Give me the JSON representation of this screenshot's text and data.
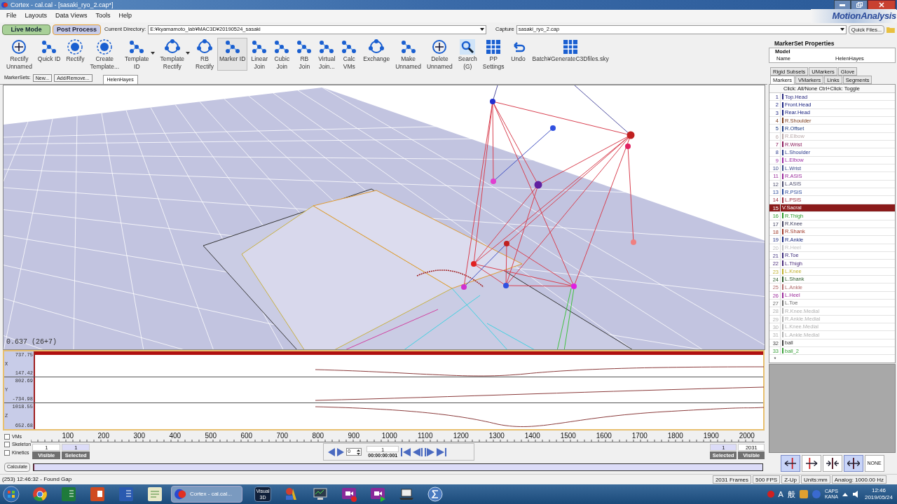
{
  "window": {
    "title": "Cortex  - cal.cal - [sasaki_ryo_2.cap*]"
  },
  "menu": [
    "File",
    "Layouts",
    "Data Views",
    "Tools",
    "Help"
  ],
  "modes": [
    {
      "label": "Live Mode",
      "selected": false
    },
    {
      "label": "Post Process",
      "selected": true
    }
  ],
  "directory": {
    "label": "Current Directory:",
    "value": "E:¥kyamamoto_lab¥MAC3D¥20190524_sasaki"
  },
  "capture": {
    "label": "Capture",
    "value": "sasaki_ryo_2.cap"
  },
  "quick_files": "Quick Files...",
  "logo": "MotionAnalysis",
  "toolbar": [
    {
      "lines": [
        "Rectify",
        "Unnamed"
      ],
      "kind": "cross",
      "dropdown": false,
      "selected": false
    },
    {
      "lines": [
        "Quick ID"
      ],
      "kind": "dots",
      "dropdown": false,
      "selected": false
    },
    {
      "lines": [
        "Rectify"
      ],
      "kind": "target",
      "dropdown": false,
      "selected": false
    },
    {
      "lines": [
        "Create",
        "Template..."
      ],
      "kind": "target",
      "dropdown": false,
      "selected": false
    },
    {
      "lines": [
        "Template",
        "ID"
      ],
      "kind": "dots",
      "dropdown": true,
      "selected": false
    },
    {
      "lines": [
        "Template",
        "Rectify"
      ],
      "kind": "ring",
      "dropdown": true,
      "selected": false
    },
    {
      "lines": [
        "RB",
        "Rectify"
      ],
      "kind": "ring",
      "dropdown": false,
      "selected": false
    },
    {
      "lines": [
        "Marker ID"
      ],
      "kind": "dots",
      "dropdown": false,
      "selected": true
    },
    {
      "lines": [
        "Linear",
        "Join"
      ],
      "kind": "dots",
      "dropdown": false,
      "selected": false
    },
    {
      "lines": [
        "Cubic",
        "Join"
      ],
      "kind": "dots",
      "dropdown": false,
      "selected": false
    },
    {
      "lines": [
        "RB",
        "Join"
      ],
      "kind": "dots",
      "dropdown": false,
      "selected": false
    },
    {
      "lines": [
        "Virtual",
        "Join..."
      ],
      "kind": "dots",
      "dropdown": false,
      "selected": false
    },
    {
      "lines": [
        "Calc",
        "VMs"
      ],
      "kind": "dots",
      "dropdown": false,
      "selected": false
    },
    {
      "lines": [
        "Exchange"
      ],
      "kind": "ring",
      "dropdown": false,
      "selected": false
    },
    {
      "lines": [
        "Make",
        "Unnamed"
      ],
      "kind": "dots",
      "dropdown": false,
      "selected": false
    },
    {
      "lines": [
        "Delete",
        "Unnamed"
      ],
      "kind": "cross",
      "dropdown": false,
      "selected": false
    },
    {
      "lines": [
        "Search",
        "(G)"
      ],
      "kind": "search",
      "dropdown": false,
      "selected": false
    },
    {
      "lines": [
        "PP",
        "Settings"
      ],
      "kind": "grid",
      "dropdown": false,
      "selected": false
    },
    {
      "lines": [
        "Undo"
      ],
      "kind": "undo",
      "dropdown": false,
      "selected": false
    },
    {
      "lines": [
        "Batch¥GenerateC3Dfiles.sky"
      ],
      "kind": "grid",
      "dropdown": false,
      "selected": false
    }
  ],
  "marker_sets": {
    "label": "MarkerSets:",
    "buttons": [
      "New...",
      "Add/Remove..."
    ],
    "tabs": [
      {
        "label": "HelenHayes",
        "selected": true
      }
    ]
  },
  "viewport": {
    "readout": "0.637 (26+7)"
  },
  "graphs": [
    {
      "axis": "X",
      "max": "737.75",
      "min": "147.42"
    },
    {
      "axis": "Y",
      "max": "802.69",
      "min": "-734.98"
    },
    {
      "axis": "Z",
      "max": "1018.55",
      "min": "652.68"
    }
  ],
  "ruler": [
    "100",
    "200",
    "300",
    "400",
    "500",
    "600",
    "700",
    "800",
    "900",
    "1000",
    "1100",
    "1200",
    "1300",
    "1400",
    "1500",
    "1600",
    "1700",
    "1800",
    "1900",
    "2000"
  ],
  "options": [
    {
      "label": "VMs",
      "checked": false
    },
    {
      "label": "Skeleton",
      "checked": false
    },
    {
      "label": "Kinetics",
      "checked": false
    }
  ],
  "range_left": {
    "first": "1",
    "second": "1",
    "first_label": "Visible",
    "second_label": "Selected"
  },
  "playback": {
    "step": "0",
    "frame": "1",
    "timecode": "00:00:00:001"
  },
  "range_right": {
    "first": "1",
    "second": "2031",
    "first_label": "Selected",
    "second_label": "Visible"
  },
  "calculate": {
    "label": "Calculate",
    "level": 0
  },
  "status": {
    "message": "(253) 12:46:32 - Found Gap",
    "fields": [
      "2031 Frames",
      "500 FPS",
      "Z-Up",
      "Units:mm",
      "Analog: 1000.00 Hz"
    ]
  },
  "properties": {
    "title": "MarkerSet Properties",
    "group": "Model",
    "rows": [
      {
        "name": "Name",
        "value": "HelenHayes"
      }
    ]
  },
  "tab_rows": [
    [
      {
        "label": "Rigid Subsets",
        "selected": false
      },
      {
        "label": "UMarkers",
        "selected": false
      },
      {
        "label": "Glove",
        "selected": false
      }
    ],
    [
      {
        "label": "Markers",
        "selected": true
      },
      {
        "label": "VMarkers",
        "selected": false
      },
      {
        "label": "Links",
        "selected": false
      },
      {
        "label": "Segments",
        "selected": false
      }
    ]
  ],
  "marker_list": {
    "hint": "Click: All/None  Ctrl+Click: Toggle",
    "new_row": "*",
    "markers": [
      {
        "number": "1",
        "name": "Top.Head",
        "color": "#2a2a80",
        "selected": false
      },
      {
        "number": "2",
        "name": "Front.Head",
        "color": "#1a2380",
        "selected": false
      },
      {
        "number": "3",
        "name": "Rear.Head",
        "color": "#1a2380",
        "selected": false
      },
      {
        "number": "4",
        "name": "R.Shoulder",
        "color": "#7a3a1a",
        "selected": false
      },
      {
        "number": "5",
        "name": "R.Offset",
        "color": "#1a3a80",
        "selected": false
      },
      {
        "number": "6",
        "name": "R.Elbow",
        "color": "#b8a8a8",
        "selected": false
      },
      {
        "number": "7",
        "name": "R.Wrist",
        "color": "#8a1a5a",
        "selected": false
      },
      {
        "number": "8",
        "name": "L.Shoulder",
        "color": "#2a3a8a",
        "selected": false
      },
      {
        "number": "9",
        "name": "L.Elbow",
        "color": "#9a2aa0",
        "selected": false
      },
      {
        "number": "10",
        "name": "L.Wrist",
        "color": "#3a4a8a",
        "selected": false
      },
      {
        "number": "11",
        "name": "R.ASIS",
        "color": "#9a2a9a",
        "selected": false
      },
      {
        "number": "12",
        "name": "L.ASIS",
        "color": "#4a4a6a",
        "selected": false
      },
      {
        "number": "13",
        "name": "R.PSIS",
        "color": "#2a4a9a",
        "selected": false
      },
      {
        "number": "14",
        "name": "L.PSIS",
        "color": "#9a2a3a",
        "selected": false
      },
      {
        "number": "15",
        "name": "V.Sacral",
        "color": "#8a1a1a",
        "selected": true
      },
      {
        "number": "16",
        "name": "R.Thigh",
        "color": "#2a9a2a",
        "selected": false
      },
      {
        "number": "17",
        "name": "R.Knee",
        "color": "#3a3a5a",
        "selected": false
      },
      {
        "number": "18",
        "name": "R.Shank",
        "color": "#a03a2a",
        "selected": false
      },
      {
        "number": "19",
        "name": "R.Ankle",
        "color": "#1a2a80",
        "selected": false
      },
      {
        "number": "20",
        "name": "R.Heel",
        "color": "#c0c0c0",
        "selected": false
      },
      {
        "number": "21",
        "name": "R.Toe",
        "color": "#3a2a7a",
        "selected": false
      },
      {
        "number": "22",
        "name": "L.Thigh",
        "color": "#4a2a7a",
        "selected": false
      },
      {
        "number": "23",
        "name": "L.Knee",
        "color": "#c0b030",
        "selected": false
      },
      {
        "number": "24",
        "name": "L.Shank",
        "color": "#2a5a2a",
        "selected": false
      },
      {
        "number": "25",
        "name": "L.Ankle",
        "color": "#b06a6a",
        "selected": false
      },
      {
        "number": "26",
        "name": "L.Heel",
        "color": "#9a2a9a",
        "selected": false
      },
      {
        "number": "27",
        "name": "L.Toe",
        "color": "#6a6a6a",
        "selected": false
      },
      {
        "number": "28",
        "name": "R.Knee.Medial",
        "color": "#b0b0b0",
        "selected": false
      },
      {
        "number": "29",
        "name": "R.Ankle.Medial",
        "color": "#b0b0b0",
        "selected": false
      },
      {
        "number": "30",
        "name": "L.Knee.Medial",
        "color": "#b0b0b0",
        "selected": false
      },
      {
        "number": "31",
        "name": "L.Ankle.Medial",
        "color": "#b0b0b0",
        "selected": false
      },
      {
        "number": "32",
        "name": "ball",
        "color": "#3a3a3a",
        "selected": false
      },
      {
        "number": "33",
        "name": "ball_2",
        "color": "#3aa03a",
        "selected": false
      }
    ]
  },
  "view_buttons": [
    {
      "kind": "left",
      "selected": true
    },
    {
      "kind": "right",
      "selected": false
    },
    {
      "kind": "collapse",
      "selected": false
    },
    {
      "kind": "expand",
      "selected": true
    },
    {
      "kind": "none",
      "label": "NONE",
      "selected": false
    }
  ],
  "taskbar": {
    "apps": [
      {
        "kind": "chrome"
      },
      {
        "kind": "spreadsheet"
      },
      {
        "kind": "slides"
      },
      {
        "kind": "document"
      },
      {
        "kind": "notepad"
      }
    ],
    "active": {
      "label": "Cortex  - cal.cal..."
    },
    "apps_right": [
      {
        "kind": "visual3d",
        "label": "Visual 3D"
      },
      {
        "kind": "figure"
      },
      {
        "kind": "monitor"
      },
      {
        "kind": "video-record"
      },
      {
        "kind": "video-play"
      },
      {
        "kind": "laptop"
      },
      {
        "kind": "sigma"
      }
    ],
    "tray": [
      "A",
      "般",
      "CAPS",
      "KANA"
    ],
    "time": "12:46",
    "date": "2019/05/24"
  }
}
